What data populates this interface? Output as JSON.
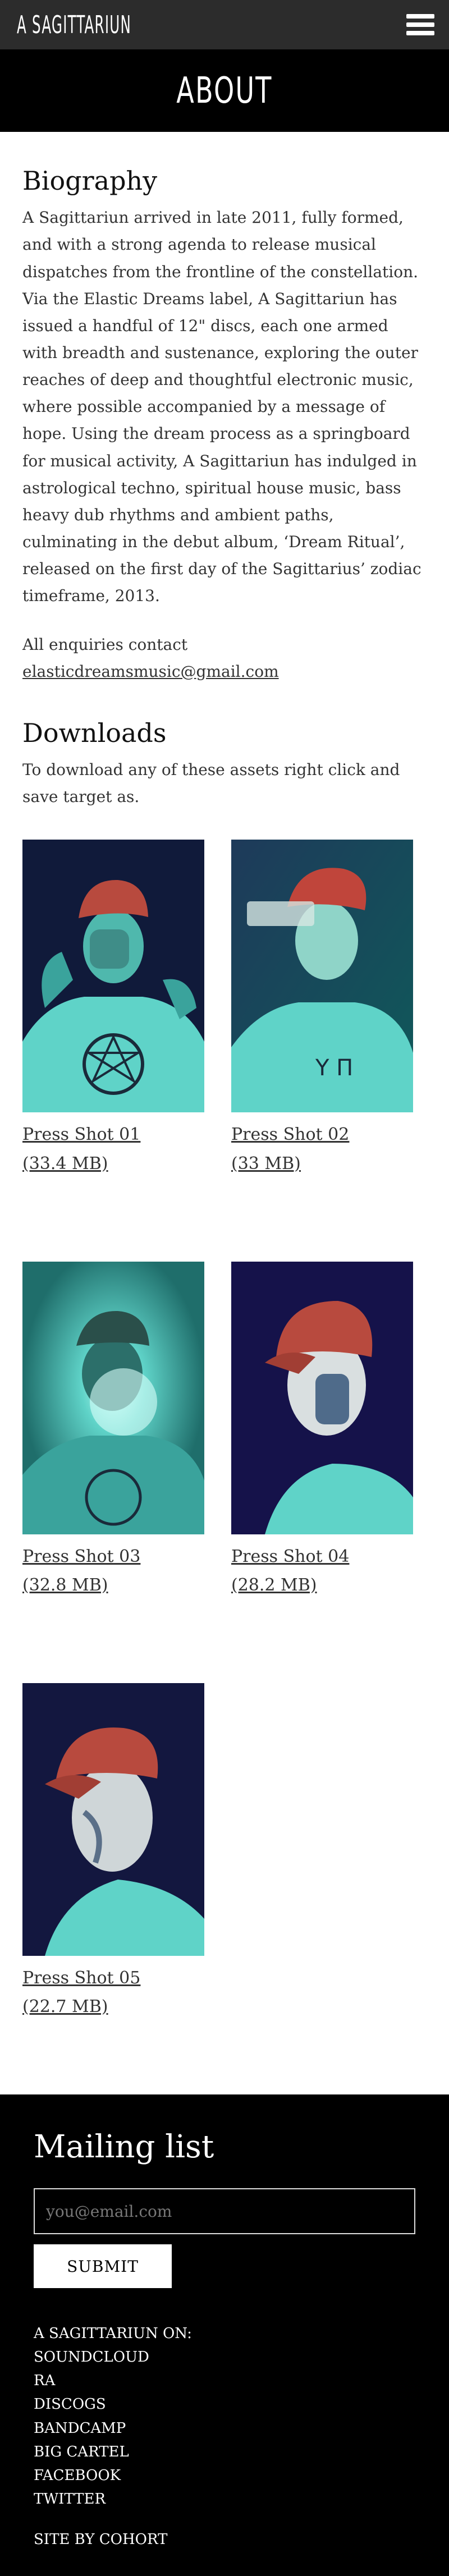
{
  "header": {
    "logo": "A Sagittariun"
  },
  "hero": {
    "title": "About"
  },
  "biography": {
    "title": "Biography",
    "text": "A Sagittariun arrived in late 2011, fully formed, and with a strong agenda to release musical dispatches from the frontline of the constellation. Via the Elastic Dreams label, A Sagittariun has issued a handful of 12\" discs, each one armed with breadth and sustenance, exploring the outer reaches of deep and thoughtful electronic music, where possible accompanied by a message of hope. Using the dream process as a springboard for musical activity, A Sagittariun has indulged in astrological techno, spiritual house music, bass heavy dub rhythms and ambient paths, culminating in the debut album, ‘Dream Ritual’, released on the first day of the Sagittarius’ zodiac timeframe, 2013.",
    "contact_label": "All enquiries contact",
    "contact_email": "elasticdreamsmusic@gmail.com"
  },
  "downloads": {
    "title": "Downloads",
    "intro": "To download any of these assets right click and save target as.",
    "items": [
      {
        "name": "Press Shot 01",
        "size": "(33.4 MB)"
      },
      {
        "name": "Press Shot 02",
        "size": "(33 MB)"
      },
      {
        "name": "Press Shot 03",
        "size": "(32.8 MB)"
      },
      {
        "name": "Press Shot 04",
        "size": "(28.2 MB)"
      },
      {
        "name": "Press Shot 05",
        "size": "(22.7 MB)"
      }
    ]
  },
  "footer": {
    "title": "Mailing list",
    "email_placeholder": "you@email.com",
    "submit_label": "SUBMIT",
    "on_label": "A SAGITTARIUN ON:",
    "links": [
      "SOUNDCLOUD",
      "RA",
      "DISCOGS",
      "BANDCAMP",
      "BIG CARTEL",
      "FACEBOOK",
      "TWITTER"
    ],
    "credit": "SITE BY COHORT"
  },
  "colors": {
    "topbar": "#2c2c2c",
    "page": "#ffffff",
    "footer": "#000000",
    "photo_navy": "#13173f",
    "photo_teal": "#2fc3b4",
    "cap_red": "#b84a3e"
  }
}
